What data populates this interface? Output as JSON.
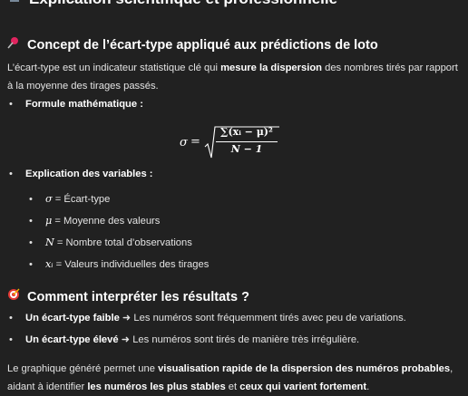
{
  "top_heading": {
    "icon": "microscope-icon",
    "text": "Explication scientifique et professionnelle"
  },
  "section1": {
    "icon": "pushpin-icon",
    "title": "Concept de l’écart-type appliqué aux prédictions de loto",
    "intro_part1": "L’écart-type est un indicateur statistique clé qui ",
    "intro_bold": "mesure la dispersion",
    "intro_part2": " des nombres tirés par rapport à la moyenne des tirages passés.",
    "bullet_formula": "Formule mathématique :",
    "formula": {
      "lhs": "σ",
      "eq": "=",
      "numerator": "∑(xᵢ − μ)²",
      "denominator": "N − 1"
    },
    "bullet_variables": "Explication des variables :",
    "variables": [
      {
        "symbol": "σ",
        "text": " = Écart-type"
      },
      {
        "symbol": "μ",
        "text": " = Moyenne des valeurs"
      },
      {
        "symbol": "N",
        "text": " = Nombre total d’observations"
      },
      {
        "symbol": "xᵢ",
        "text": " = Valeurs individuelles des tirages"
      }
    ]
  },
  "section2": {
    "icon": "target-icon",
    "title": "Comment interpréter les résultats ?",
    "items": [
      {
        "bold": "Un écart-type faible",
        "text": " ➜ Les numéros sont fréquemment tirés avec peu de variations."
      },
      {
        "bold": "Un écart-type élevé",
        "text": " ➜ Les numéros sont tirés de manière très irrégulière."
      }
    ]
  },
  "conclusion": {
    "part1": "Le graphique généré permet une ",
    "bold1": "visualisation rapide de la dispersion des numéros probables",
    "part2": ", aidant à identifier ",
    "bold2": "les numéros les plus stables",
    "part3": " et ",
    "bold3": "ceux qui varient fortement",
    "part4": "."
  },
  "colors": {
    "background": "#212121",
    "text": "#ececec",
    "heading": "#ffffff",
    "pin": "#e0245e",
    "target": "#e53935"
  }
}
